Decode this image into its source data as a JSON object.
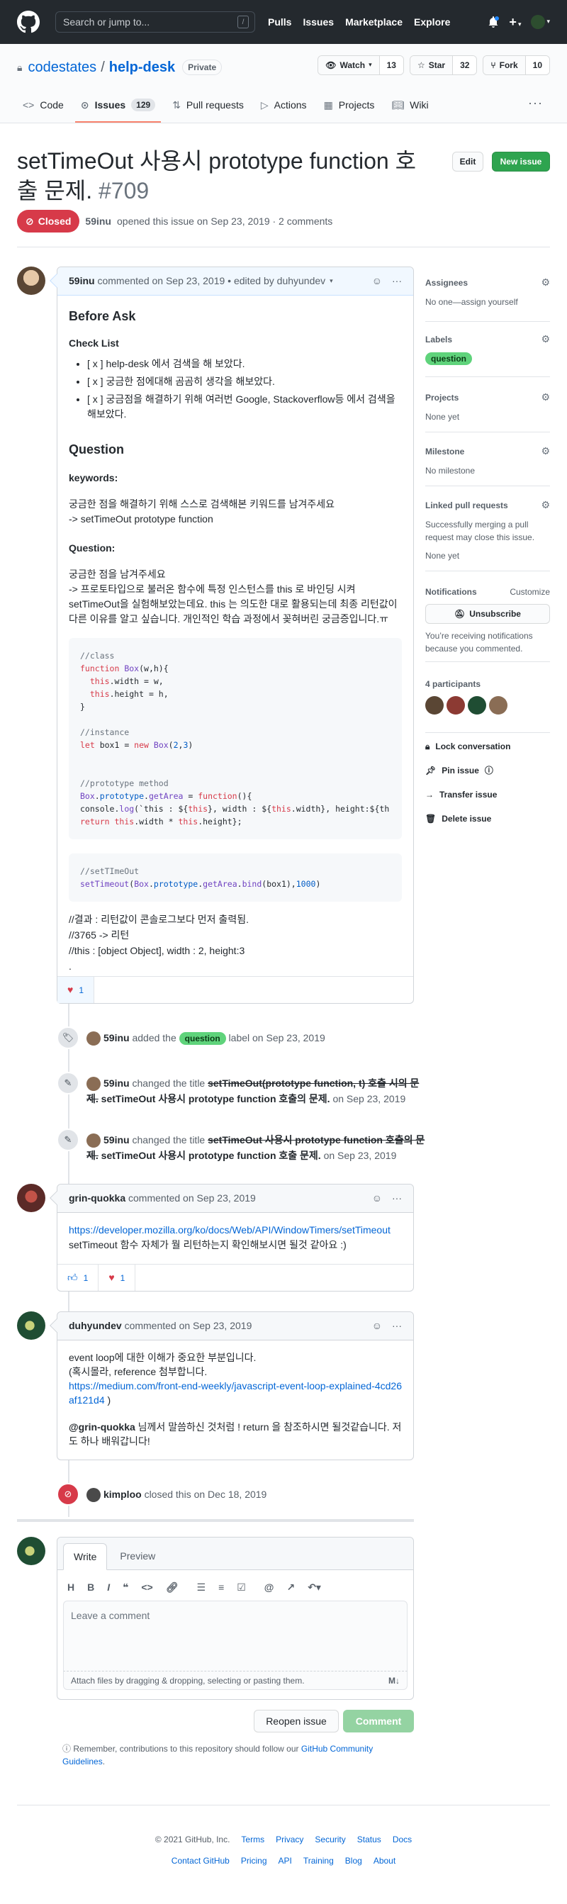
{
  "header": {
    "search_placeholder": "Search or jump to...",
    "search_key": "/",
    "nav": [
      "Pulls",
      "Issues",
      "Marketplace",
      "Explore"
    ]
  },
  "repo": {
    "owner": "codestates",
    "name": "help-desk",
    "visibility": "Private",
    "watch_label": "Watch",
    "watch_count": "13",
    "star_label": "Star",
    "star_count": "32",
    "fork_label": "Fork",
    "fork_count": "10",
    "tabs": [
      {
        "label": "Code",
        "icon": "code-icon"
      },
      {
        "label": "Issues",
        "icon": "issue-icon",
        "count": "129"
      },
      {
        "label": "Pull requests",
        "icon": "pull-request-icon"
      },
      {
        "label": "Actions",
        "icon": "play-icon"
      },
      {
        "label": "Projects",
        "icon": "project-icon"
      },
      {
        "label": "Wiki",
        "icon": "book-icon"
      }
    ]
  },
  "issue": {
    "title": "setTimeOut 사용시 prototype function 호출 문제.",
    "number": "#709",
    "state": "Closed",
    "author": "59inu",
    "opened_text": "opened this issue on Sep 23, 2019 · 2 comments",
    "edit_label": "Edit",
    "new_issue_label": "New issue"
  },
  "first_comment": {
    "author": "59inu",
    "meta": "commented on Sep 23, 2019 • edited by duhyundev",
    "h_before": "Before Ask",
    "h_checklist": "Check List",
    "checklist": [
      "[ x ] help-desk 에서 검색을 해 보았다.",
      "[ x ] 궁금한 점에대해 곰곰히 생각을 해보았다.",
      "[ x ] 궁금점을 해결하기 위해 여러번 Google, Stackoverflow등 에서 검색을 해보았다."
    ],
    "h_question": "Question",
    "h_keywords": "keywords:",
    "keywords_1": "궁금한 점을 해결하기 위해 스스로 검색해본 키워드를 남겨주세요",
    "keywords_2": "-> setTimeOut prototype function",
    "h_question2": "Question:",
    "question_1": "궁금한 점을 남겨주세요",
    "question_2": "-> 프로토타입으로 불러온 함수에 특정 인스턴스를 this 로 바인딩 시켜 setTimeOut을 실험해보았는데요. this 는 의도한 대로 활용되는데 최종 리턴값이 다른 이유를 알고 싶습니다. 개인적인 학습 과정에서 꽂혀버린 궁금증입니다.ㅠ",
    "result_1": "//결과 : 리턴값이 콘솔로그보다 먼저 출력됨.",
    "result_2": "//3765 -> 리턴",
    "result_3": "//this : [object Object], width : 2, height:3",
    "result_4": ".",
    "reaction": "1"
  },
  "events": {
    "label_actor": "59inu",
    "label_action": "added the",
    "label_name": "question",
    "label_date": "label on Sep 23, 2019",
    "rename1_actor": "59inu",
    "rename1_action": "changed the title",
    "rename1_old": "setTimeOut(prototype function, t) 호출 시의 문제.",
    "rename1_new": "setTimeOut 사용시 prototype function 호출의 문제.",
    "rename1_date": "on Sep 23, 2019",
    "rename2_actor": "59inu",
    "rename2_action": "changed the title",
    "rename2_old": "setTimeOut 사용시 prototype function 호출의 문제.",
    "rename2_new": "setTimeOut 사용시 prototype function 호출 문제.",
    "rename2_date": "on Sep 23, 2019",
    "closed_actor": "kimploo",
    "closed_text": "closed this on Dec 18, 2019"
  },
  "comment2": {
    "author": "grin-quokka",
    "meta": "commented on Sep 23, 2019",
    "link": "https://developer.mozilla.org/ko/docs/Web/API/WindowTimers/setTimeout",
    "text": "setTimeout 함수 자체가 뭘 리턴하는지 확인해보시면 될것 같아요 :)",
    "thumbs": "1",
    "heart": "1"
  },
  "comment3": {
    "author": "duhyundev",
    "meta": "commented on Sep 23, 2019",
    "line1": "event loop에 대한 이해가 중요한 부분입니다.",
    "line2": "(혹시몰라, reference 첨부합니다.",
    "link": "https://medium.com/front-end-weekly/javascript-event-loop-explained-4cd26af121d4",
    "line3": ")",
    "mention": "@grin-quokka",
    "line4": "님께서 말씀하신 것처럼 ! return 을 참조하시면 될것같습니다. 저도 하나 배워갑니다!"
  },
  "editor": {
    "tab_write": "Write",
    "tab_preview": "Preview",
    "placeholder": "Leave a comment",
    "attach": "Attach files by dragging & dropping, selecting or pasting them.",
    "reopen": "Reopen issue",
    "comment": "Comment",
    "guidelines_pre": "Remember, contributions to this repository should follow our",
    "guidelines_link": "GitHub Community Guidelines",
    "guidelines_post": "."
  },
  "sidebar": {
    "assignees_h": "Assignees",
    "assignees_v": "No one—assign yourself",
    "labels_h": "Labels",
    "labels_v": "question",
    "projects_h": "Projects",
    "projects_v": "None yet",
    "milestone_h": "Milestone",
    "milestone_v": "No milestone",
    "linked_h": "Linked pull requests",
    "linked_desc": "Successfully merging a pull request may close this issue.",
    "linked_v": "None yet",
    "notif_h": "Notifications",
    "notif_customize": "Customize",
    "unsubscribe": "Unsubscribe",
    "notif_desc": "You’re receiving notifications because you commented.",
    "participants_h": "4 participants",
    "lock": "Lock conversation",
    "pin": "Pin issue",
    "transfer": "Transfer issue",
    "delete": "Delete issue"
  },
  "footer": {
    "copyright": "© 2021 GitHub, Inc.",
    "row1": [
      "Terms",
      "Privacy",
      "Security",
      "Status",
      "Docs"
    ],
    "row2": [
      "Contact GitHub",
      "Pricing",
      "API",
      "Training",
      "Blog",
      "About"
    ]
  },
  "colors": {
    "closed": "#d73a49",
    "primary": "#2ea44f",
    "link": "#0366d6",
    "label_question": "#5fd37b"
  }
}
